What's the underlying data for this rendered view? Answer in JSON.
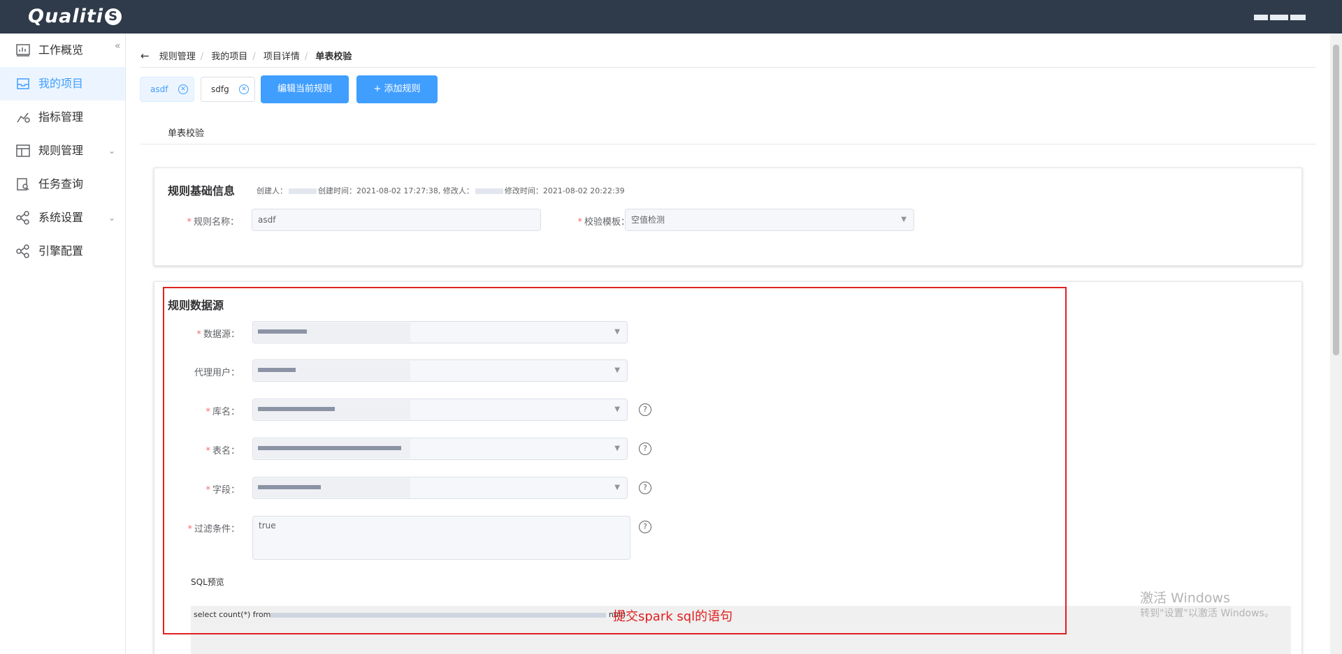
{
  "header": {
    "logo": "Qualiti",
    "logo_badge": "S"
  },
  "sidebar": {
    "items": [
      {
        "label": "工作概览",
        "icon": "chart-board-icon"
      },
      {
        "label": "我的项目",
        "icon": "inbox-icon",
        "active": true
      },
      {
        "label": "指标管理",
        "icon": "metrics-icon"
      },
      {
        "label": "规则管理",
        "icon": "layout-icon",
        "expandable": true
      },
      {
        "label": "任务查询",
        "icon": "search-doc-icon"
      },
      {
        "label": "系统设置",
        "icon": "share-icon",
        "expandable": true
      },
      {
        "label": "引擎配置",
        "icon": "share-icon"
      }
    ]
  },
  "breadcrumb": {
    "items": [
      "规则管理",
      "我的项目",
      "项目详情"
    ],
    "current": "单表校验"
  },
  "tags": [
    "asdf",
    "sdfg"
  ],
  "buttons": {
    "edit": "编辑当前规则",
    "add": "+ 添加规则"
  },
  "tab": "单表校验",
  "basic_info": {
    "title": "规则基础信息",
    "created_label": "创建人：",
    "created_time": "创建时间：2021-08-02 17:27:38,",
    "modifier_label": "修改人：",
    "modified_time": "修改时间：2021-08-02 20:22:39",
    "rule_name_label": "规则名称：",
    "rule_name_value": "asdf",
    "template_label": "校验模板：",
    "template_value": "空值检测"
  },
  "datasource": {
    "title": "规则数据源",
    "fields": [
      {
        "label": "数据源：",
        "required": true
      },
      {
        "label": "代理用户：",
        "required": false
      },
      {
        "label": "库名：",
        "required": true,
        "help": true
      },
      {
        "label": "表名：",
        "required": true,
        "help": true
      },
      {
        "label": "字段：",
        "required": true,
        "help": true
      }
    ],
    "filter_label": "过滤条件：",
    "filter_value": "true",
    "sql_label": "SQL预览",
    "sql_prefix": "select count(*) from",
    "sql_suffix": "null)"
  },
  "annotation": "提交spark sql的语句",
  "watermark": {
    "line1": "激活 Windows",
    "line2": "转到\"设置\"以激活 Windows。"
  },
  "colors": {
    "primary": "#409eff",
    "topbar": "#2f3a4a",
    "annotation": "#e02020"
  }
}
